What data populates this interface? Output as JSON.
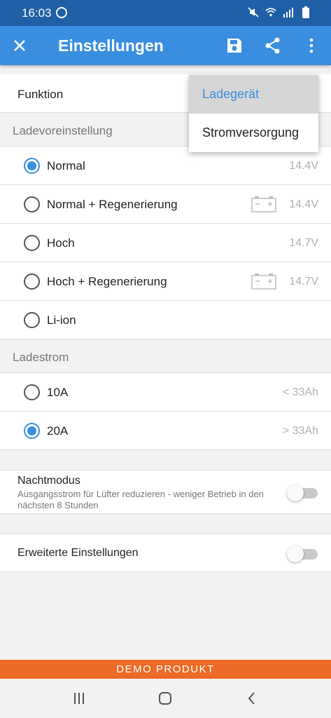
{
  "status_bar": {
    "time": "16:03",
    "icons": [
      "whatsapp-icon",
      "mute-icon",
      "wifi-icon",
      "signal-icon",
      "battery-icon"
    ]
  },
  "app_bar": {
    "title": "Einstellungen",
    "actions": [
      "close-icon",
      "save-icon",
      "share-icon",
      "more-vert-icon"
    ]
  },
  "funktion": {
    "label": "Funktion"
  },
  "dropdown": {
    "options": [
      "Ladegerät",
      "Stromversorgung"
    ],
    "selected": "Ladegerät"
  },
  "ladevoreinstellung": {
    "header": "Ladevoreinstellung",
    "options": [
      {
        "label": "Normal",
        "value": "14.4V",
        "selected": true,
        "battery_icon": false
      },
      {
        "label": "Normal + Regenerierung",
        "value": "14.4V",
        "selected": false,
        "battery_icon": true
      },
      {
        "label": "Hoch",
        "value": "14.7V",
        "selected": false,
        "battery_icon": false
      },
      {
        "label": "Hoch + Regenerierung",
        "value": "14.7V",
        "selected": false,
        "battery_icon": true
      },
      {
        "label": "Li-ion",
        "value": "",
        "selected": false,
        "battery_icon": false
      }
    ]
  },
  "ladestrom": {
    "header": "Ladestrom",
    "options": [
      {
        "label": "10A",
        "value": "< 33Ah",
        "selected": false
      },
      {
        "label": "20A",
        "value": "> 33Ah",
        "selected": true
      }
    ]
  },
  "nachtmodus": {
    "title": "Nachtmodus",
    "description": "Ausgangsstrom für Lüfter reduzieren - weniger Betrieb in den nächsten 8 Stunden",
    "enabled": false
  },
  "erweitert": {
    "label": "Erweiterte Einstellungen",
    "enabled": false
  },
  "demo_banner": "DEMO PRODUKT",
  "colors": {
    "status_bar": "#1f5fa6",
    "app_bar": "#3a8ee0",
    "accent": "#3a8ee0",
    "demo": "#ec6a25"
  }
}
